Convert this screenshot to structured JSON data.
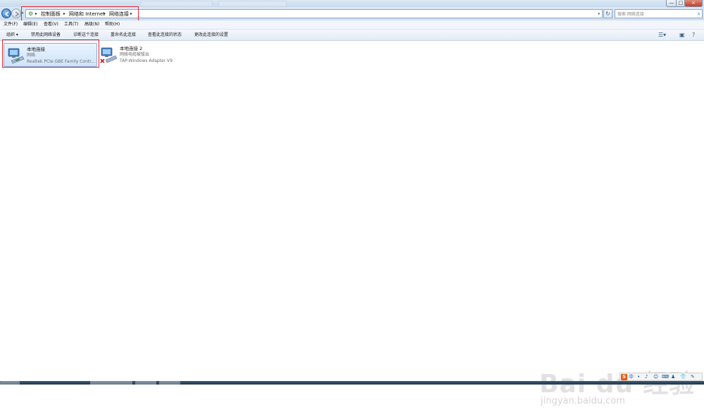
{
  "window": {
    "min_glyph": "—",
    "max_glyph": "□",
    "close_glyph": "×"
  },
  "address": {
    "crumbs": [
      "控制面板",
      "网络和 Internet",
      "网络连接"
    ],
    "separator_glyph": "▸",
    "dropdown_glyph": "▾",
    "refresh_glyph": "↻"
  },
  "search": {
    "placeholder": "搜索 网络连接"
  },
  "menu": [
    "文件(F)",
    "编辑(E)",
    "查看(V)",
    "工具(T)",
    "高级(N)",
    "帮助(H)"
  ],
  "commands": {
    "organize": "组织 ▾",
    "items": [
      "禁用此网络设备",
      "诊断这个连接",
      "重命名此连接",
      "查看此连接的状态",
      "更改此连接的设置"
    ]
  },
  "connections": [
    {
      "name": "本地连接",
      "status": "网络",
      "device": "Realtek PCIe GBE Family Contr...",
      "selected": true,
      "disconnected": false
    },
    {
      "name": "本地连接 2",
      "status": "网络电缆被拔出",
      "device": "TAP-Windows Adapter V9",
      "selected": false,
      "disconnected": true
    }
  ],
  "watermark": {
    "text": "Bai du 经验",
    "url": "jingyan.baidu.com"
  },
  "ime": {
    "logo": "S",
    "segments": [
      "中",
      "•",
      "♪",
      "☺",
      "⌨",
      "♟",
      "👕",
      "✎"
    ]
  },
  "colors": {
    "annotation": "#e2232a",
    "selection": "#cfe4fa",
    "accent": "#2d6db8"
  }
}
